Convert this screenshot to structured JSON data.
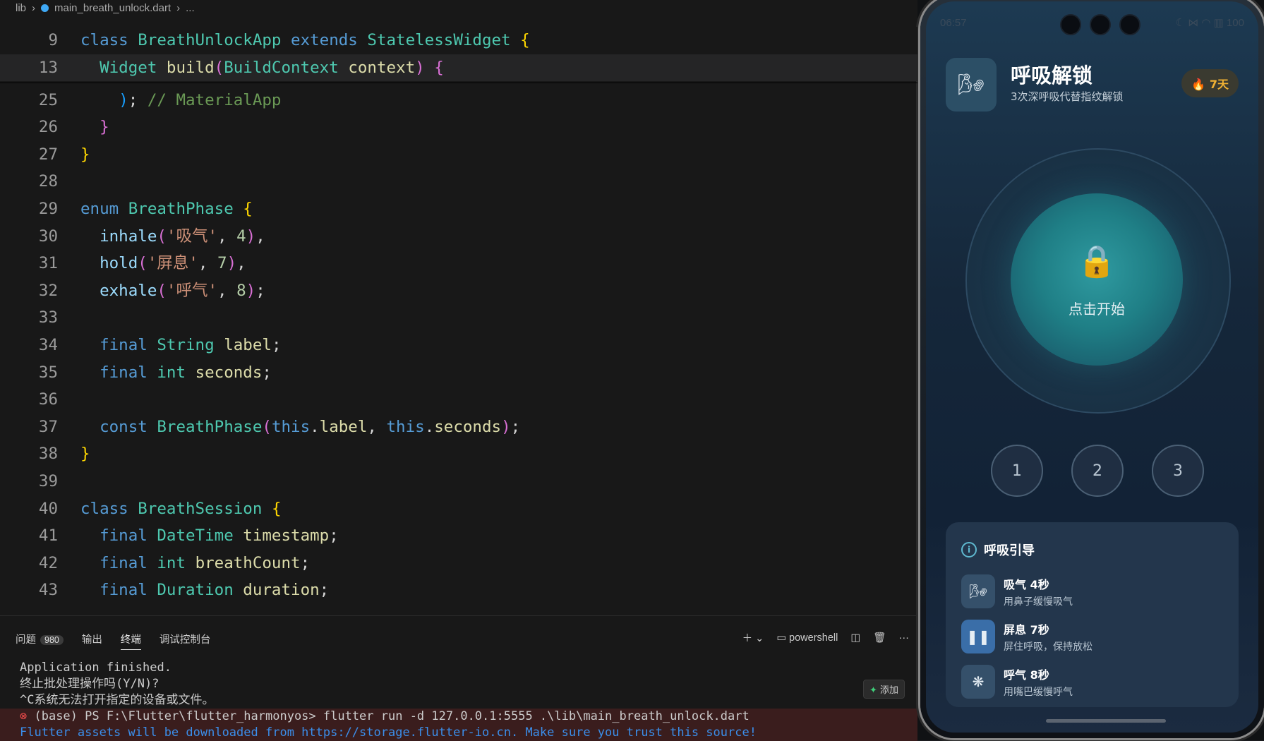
{
  "breadcrumb": {
    "folder": "lib",
    "file": "main_breath_unlock.dart",
    "more": "..."
  },
  "sticky": [
    {
      "num": "9",
      "code": "class BreathUnlockApp extends StatelessWidget {"
    },
    {
      "num": "13",
      "code": "Widget build(BuildContext context) {"
    }
  ],
  "panel": {
    "tabs": [
      {
        "label": "问题",
        "badge": "980"
      },
      {
        "label": "输出"
      },
      {
        "label": "终端"
      },
      {
        "label": "调试控制台"
      }
    ],
    "shell": "powershell",
    "add_label": "添加",
    "terminal": [
      "Application finished.",
      "终止批处理操作吗(Y/N)?",
      "^C系统无法打开指定的设备或文件。",
      "(base) PS F:\\Flutter\\flutter_harmonyos> flutter run -d 127.0.0.1:5555 .\\lib\\main_breath_unlock.dart",
      "Flutter assets will be downloaded from https://storage.flutter-io.cn. Make sure you trust this source!"
    ]
  },
  "phone": {
    "status_time": "06:57",
    "status_battery": "100",
    "app_title": "呼吸解锁",
    "app_subtitle": "3次深呼吸代替指纹解锁",
    "streak": "7天",
    "start_label": "点击开始",
    "counts": [
      "1",
      "2",
      "3"
    ],
    "guide_title": "呼吸引导",
    "guide_items": [
      {
        "title": "吸气 4秒",
        "desc": "用鼻子缓慢吸气",
        "icon": "wind-icon"
      },
      {
        "title": "屏息 7秒",
        "desc": "屏住呼吸，保持放松",
        "icon": "pause-icon"
      },
      {
        "title": "呼气 8秒",
        "desc": "用嘴巴缓慢呼气",
        "icon": "air-icon"
      }
    ]
  }
}
